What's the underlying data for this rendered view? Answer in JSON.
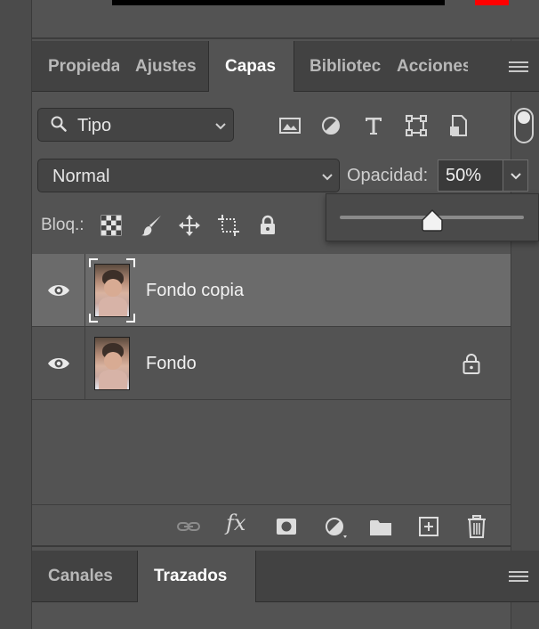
{
  "panel_tabs": {
    "propiedades": "Propiedades",
    "ajustes": "Ajustes",
    "capas": "Capas",
    "bibliotecas": "Bibliotecas",
    "acciones": "Acciones"
  },
  "filter": {
    "label": "Tipo"
  },
  "blend": {
    "mode": "Normal"
  },
  "opacity": {
    "label": "Opacidad:",
    "value": "50%",
    "slider_fraction": 0.5
  },
  "lock": {
    "label": "Bloq.:"
  },
  "layers": [
    {
      "name": "Fondo copia",
      "selected": true,
      "locked": false,
      "visible": true
    },
    {
      "name": "Fondo",
      "selected": false,
      "locked": true,
      "visible": true
    }
  ],
  "lower_tabs": {
    "canales": "Canales",
    "trazados": "Trazados"
  },
  "colors": {
    "panel_bg": "#535353",
    "tab_bg": "#424242",
    "selected_row": "#6b6b6b",
    "accent_red": "#ff0000"
  },
  "icons": {
    "filter": [
      "pixel-layer-filter-icon",
      "adjustment-layer-filter-icon",
      "type-layer-filter-icon",
      "shape-layer-filter-icon",
      "smart-object-filter-icon"
    ],
    "lock": [
      "lock-transparent-pixels-icon",
      "lock-image-pixels-icon",
      "lock-position-icon",
      "lock-artboards-icon",
      "lock-all-icon"
    ],
    "bottom": [
      "link-layers-icon",
      "fx-icon",
      "add-mask-icon",
      "new-fill-adjustment-icon",
      "new-group-icon",
      "new-layer-icon",
      "delete-layer-icon"
    ]
  }
}
